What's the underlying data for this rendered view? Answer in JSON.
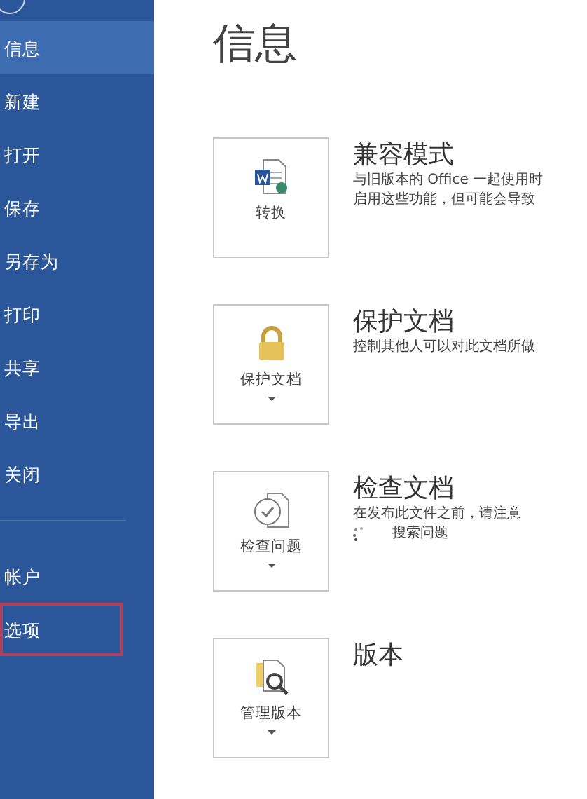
{
  "sidebar": {
    "items": [
      {
        "label": "信息",
        "selected": true,
        "highlighted": false
      },
      {
        "label": "新建",
        "selected": false,
        "highlighted": false
      },
      {
        "label": "打开",
        "selected": false,
        "highlighted": false
      },
      {
        "label": "保存",
        "selected": false,
        "highlighted": false
      },
      {
        "label": "另存为",
        "selected": false,
        "highlighted": false
      },
      {
        "label": "打印",
        "selected": false,
        "highlighted": false
      },
      {
        "label": "共享",
        "selected": false,
        "highlighted": false
      },
      {
        "label": "导出",
        "selected": false,
        "highlighted": false
      },
      {
        "label": "关闭",
        "selected": false,
        "highlighted": false
      }
    ],
    "bottom_items": [
      {
        "label": "帐户",
        "selected": false,
        "highlighted": false
      },
      {
        "label": "选项",
        "selected": false,
        "highlighted": true
      }
    ]
  },
  "page_title": "信息",
  "sections": [
    {
      "kind": "convert",
      "button": "转换",
      "dropdown": false,
      "title": "兼容模式",
      "description": [
        "与旧版本的 Office 一起使用时",
        "启用这些功能，但可能会导致"
      ]
    },
    {
      "kind": "protect",
      "button": "保护文档",
      "dropdown": true,
      "title": "保护文档",
      "description": [
        "控制其他人可以对此文档所做"
      ]
    },
    {
      "kind": "inspect",
      "button": "检查问题",
      "dropdown": true,
      "title": "检查文档",
      "description": [
        "在发布此文件之前，请注意"
      ],
      "status": "搜索问题"
    },
    {
      "kind": "versions",
      "button": "管理版本",
      "dropdown": true,
      "title": "版本"
    }
  ]
}
